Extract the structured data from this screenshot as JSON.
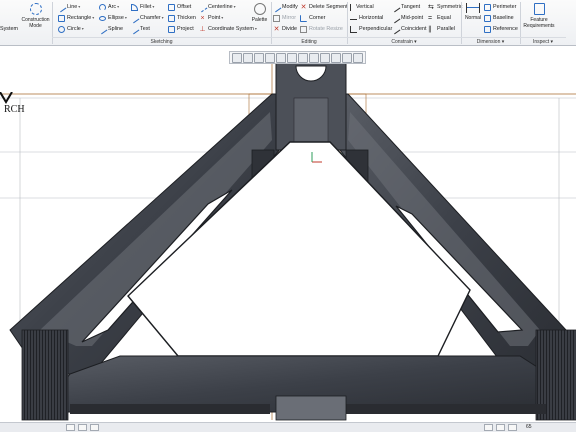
{
  "ribbon": {
    "system_tail": "System",
    "construction_mode": "Construction Mode",
    "sketching": {
      "items": [
        "Line",
        "Rectangle",
        "Circle",
        "Arc",
        "Ellipse",
        "Spline",
        "Fillet",
        "Chamfer",
        "Text",
        "Offset",
        "Thicken",
        "Project",
        "Centerline",
        "Point",
        "Coordinate System"
      ],
      "palette": "Palette"
    },
    "editing": {
      "items": [
        "Modify",
        "Mirror",
        "Divide",
        "Delete Segment",
        "Corner",
        "Rotate Resize"
      ]
    },
    "constrain": {
      "items": [
        "Vertical",
        "Horizontal",
        "Perpendicular",
        "Tangent",
        "Mid-point",
        "Coincident",
        "Symmetric",
        "Equal",
        "Parallel"
      ]
    },
    "dimension": {
      "normal": "Normal",
      "items": [
        "Perimeter",
        "Baseline",
        "Reference"
      ]
    },
    "inspect": {
      "feature_requirements": "Feature Requirements"
    },
    "groups": {
      "sketching": "Sketching",
      "editing": "Editing",
      "constrain": "Constrain ▾",
      "dimension": "Dimension ▾",
      "inspect": "Inspect ▾"
    }
  },
  "logo_text": "RCH",
  "status": {
    "number": "65"
  },
  "colors": {
    "ribbon_accent": "#2f6fc4",
    "model_dark": "#3a3d44",
    "model_mid": "#6d7179",
    "ref_orange": "#c8782a",
    "ref_green": "#2e9e5b"
  }
}
